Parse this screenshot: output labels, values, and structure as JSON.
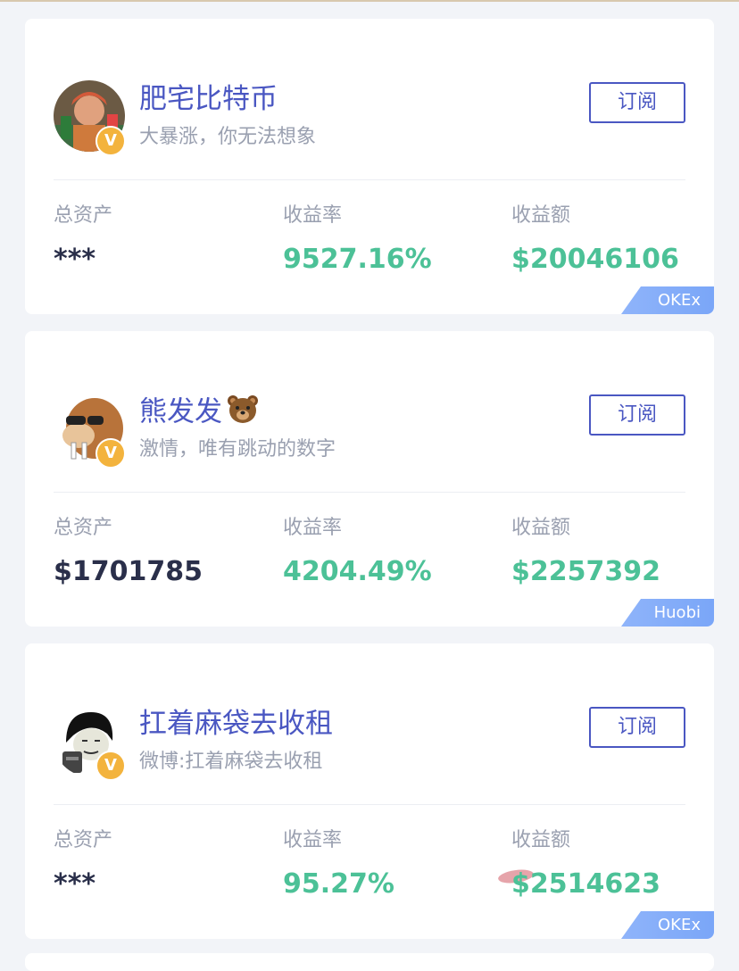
{
  "subscribe_label": "订阅",
  "stat_labels": {
    "total_assets": "总资产",
    "return_rate": "收益率",
    "profit_amount": "收益额"
  },
  "cards": [
    {
      "name": "肥宅比特币",
      "motto": "大暴涨，你无法想象",
      "total_assets": "***",
      "return_rate": "9527.16%",
      "profit_amount": "$20046106",
      "exchange": "OKEx",
      "avatar_icon": "user-photo-avatar",
      "verified_icon": "verified-v-badge-icon"
    },
    {
      "name": "熊发发",
      "name_emoji_icon": "bear-face-icon",
      "motto": "激情，唯有跳动的数字",
      "total_assets": "$1701785",
      "return_rate": "4204.49%",
      "profit_amount": "$2257392",
      "exchange": "Huobi",
      "avatar_icon": "walrus-cartoon-avatar",
      "verified_icon": "verified-v-badge-icon"
    },
    {
      "name": "扛着麻袋去收租",
      "motto": "微博:扛着麻袋去收租",
      "total_assets": "***",
      "return_rate": "95.27%",
      "profit_amount": "$2514623",
      "exchange": "OKEx",
      "avatar_icon": "meme-face-avatar",
      "verified_icon": "verified-v-badge-icon"
    }
  ],
  "colors": {
    "accent": "#4a57c2",
    "profit_green": "#4cc197",
    "muted_text": "#9aa0b0",
    "dark_value": "#2a2f4a",
    "verified_badge": "#f3b33d",
    "exchange_tag": "#8fb4fa",
    "page_background": "#f2f4f8"
  }
}
